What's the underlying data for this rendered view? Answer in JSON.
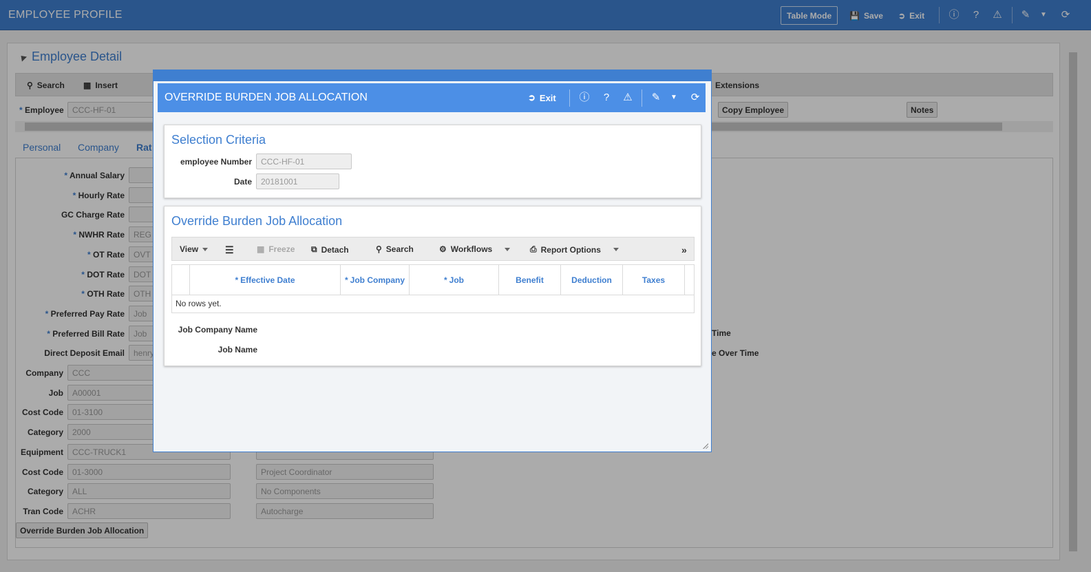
{
  "app": {
    "title": "EMPLOYEE PROFILE",
    "table_mode": "Table Mode",
    "save": "Save",
    "exit": "Exit",
    "icons": [
      "info-icon",
      "help-icon",
      "warning-icon",
      "edit-icon",
      "dropdown-icon",
      "refresh-icon"
    ]
  },
  "background": {
    "section_title": "Employee Detail",
    "toolbar": {
      "search": "Search",
      "insert": "Insert",
      "extensions": "Extensions"
    },
    "employee_label": "Employee",
    "employee_value": "CCC-HF-01",
    "copy_employee": "Copy Employee",
    "notes": "Notes",
    "tabs": [
      "Personal",
      "Company",
      "Rat"
    ],
    "fields": [
      {
        "label": "Annual Salary",
        "required": true,
        "value": ""
      },
      {
        "label": "Hourly Rate",
        "required": true,
        "value": ""
      },
      {
        "label": "GC Charge Rate",
        "required": false,
        "value": ""
      },
      {
        "label": "NWHR Rate",
        "required": true,
        "value": "REG"
      },
      {
        "label": "OT Rate",
        "required": true,
        "value": "OVT"
      },
      {
        "label": "DOT Rate",
        "required": true,
        "value": "DOT"
      },
      {
        "label": "OTH Rate",
        "required": true,
        "value": "OTH"
      },
      {
        "label": "Preferred Pay Rate",
        "required": true,
        "value": "Job"
      },
      {
        "label": "Preferred Bill Rate",
        "required": true,
        "value": "Job"
      },
      {
        "label": "Direct Deposit Email",
        "required": false,
        "value": "henry"
      }
    ],
    "lower_fields": [
      {
        "label": "Company",
        "value": "CCC",
        "desc": ""
      },
      {
        "label": "Job",
        "value": "A00001",
        "desc": ""
      },
      {
        "label": "Cost Code",
        "value": "01-3100",
        "desc": ""
      },
      {
        "label": "Category",
        "value": "2000",
        "desc": ""
      },
      {
        "label": "Equipment",
        "value": "CCC-TRUCK1",
        "desc": ""
      },
      {
        "label": "Cost Code",
        "value": "01-3000",
        "desc": "Project Coordinator"
      },
      {
        "label": "Category",
        "value": "ALL",
        "desc": "No Components"
      },
      {
        "label": "Tran Code",
        "value": "ACHR",
        "desc": "Autocharge"
      }
    ],
    "right_labels": [
      "Time",
      "e Over Time"
    ],
    "override_button": "Override Burden Job Allocation"
  },
  "modal": {
    "title": "OVERRIDE BURDEN JOB ALLOCATION",
    "exit": "Exit",
    "selection": {
      "title": "Selection Criteria",
      "employee_number_label": "employee Number",
      "employee_number_value": "CCC-HF-01",
      "date_label": "Date",
      "date_value": "20181001"
    },
    "grid": {
      "title": "Override Burden Job Allocation",
      "toolbar": {
        "view": "View",
        "freeze": "Freeze",
        "detach": "Detach",
        "search": "Search",
        "workflows": "Workflows",
        "report_options": "Report Options"
      },
      "columns": [
        {
          "label": "Effective Date",
          "required": true
        },
        {
          "label": "Job Company",
          "required": true
        },
        {
          "label": "Job",
          "required": true
        },
        {
          "label": "Benefit",
          "required": false
        },
        {
          "label": "Deduction",
          "required": false
        },
        {
          "label": "Taxes",
          "required": false
        }
      ],
      "empty_text": "No rows yet.",
      "job_company_name_label": "Job Company Name",
      "job_name_label": "Job Name"
    }
  }
}
